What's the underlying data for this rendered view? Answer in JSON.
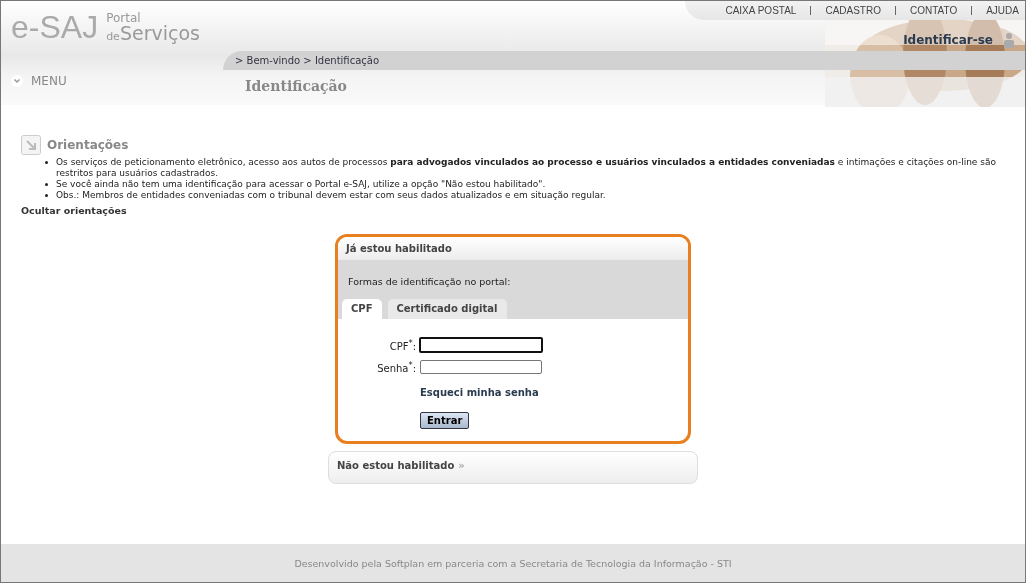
{
  "header": {
    "logo_main": "e-SAJ",
    "logo_line1": "Portal",
    "logo_line2_small": "de",
    "logo_line2": "Serviços",
    "top_links": [
      {
        "label": "CAIXA POSTAL"
      },
      {
        "label": "CADASTRO"
      },
      {
        "label": "CONTATO"
      },
      {
        "label": "AJUDA"
      }
    ],
    "identify_link": "Identificar-se",
    "breadcrumb": "> Bem-vindo > Identificação",
    "menu": "MENU",
    "page_title": "Identificação"
  },
  "guidance": {
    "title": "Orientações",
    "items": [
      "Os serviços de peticionamento eletrônico, acesso aos autos de processos **para advogados vinculados ao processo e usuários vinculados a entidades conveniadas** e intimações e citações on-line são restritos para usuários cadastrados.",
      "Se você ainda não tem uma identificação para acessar o Portal e-SAJ, utilize a opção \"Não estou habilitado\".",
      "Obs.: Membros de entidades conveniadas com o tribunal devem estar com seus dados atualizados e em situação regular."
    ],
    "toggle": "Ocultar orientações"
  },
  "login_panel": {
    "title": "Já estou habilitado",
    "highlighted": true,
    "forms_label": "Formas de identificação no portal:",
    "tabs": [
      {
        "label": "CPF",
        "selected": true
      },
      {
        "label": "Certificado digital",
        "selected": false
      }
    ],
    "fields": [
      {
        "label": "CPF$^{*}$:",
        "focused": true
      },
      {
        "label": "Senha$^{*}$:",
        "focused": false
      }
    ],
    "forgot_link": "Esqueci minha senha",
    "submit": "Entrar"
  },
  "other_panel": {
    "title": "Não estou habilitado",
    "arrow": "»"
  },
  "footer": "Desenvolvido pela Softplan em parceria com a Secretaria de Tecnologia da Informação - STI"
}
